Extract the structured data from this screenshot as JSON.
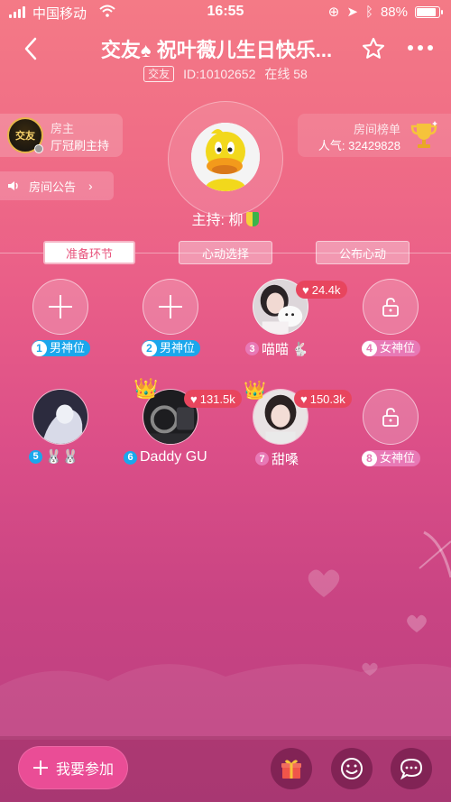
{
  "status_bar": {
    "carrier": "中国移动",
    "time": "16:55",
    "battery": "88%"
  },
  "header": {
    "title": "交友♠ 祝叶薇儿生日快乐...",
    "tag": "交友",
    "room_id": "ID:10102652",
    "online": "在线 58"
  },
  "owner": {
    "badge": "交友",
    "role": "房主",
    "name": "厅冠刷主持"
  },
  "ranking": {
    "label": "房间榜单",
    "popularity": "人气: 32429828"
  },
  "notice": {
    "label": "房间公告"
  },
  "host": {
    "label": "主持: 柳"
  },
  "tabs": [
    {
      "label": "准备环节"
    },
    {
      "label": "心动选择"
    },
    {
      "label": "公布心动"
    }
  ],
  "seats": {
    "s1": {
      "num": "1",
      "label": "男神位"
    },
    "s2": {
      "num": "2",
      "label": "男神位"
    },
    "s3": {
      "num": "3",
      "name": "喵喵",
      "hearts": "24.4k"
    },
    "s4": {
      "num": "4",
      "label": "女神位"
    },
    "s5": {
      "num": "5"
    },
    "s6": {
      "num": "6",
      "name": "Daddy GU",
      "hearts": "131.5k"
    },
    "s7": {
      "num": "7",
      "name": "甜嗓",
      "hearts": "150.3k"
    },
    "s8": {
      "num": "8",
      "label": "女神位"
    }
  },
  "bottom": {
    "join_label": "我要参加"
  },
  "colors": {
    "accent": "#ea4d96",
    "male": "#1aa7ec",
    "female": "#e879b6",
    "heart": "#e8455e"
  }
}
